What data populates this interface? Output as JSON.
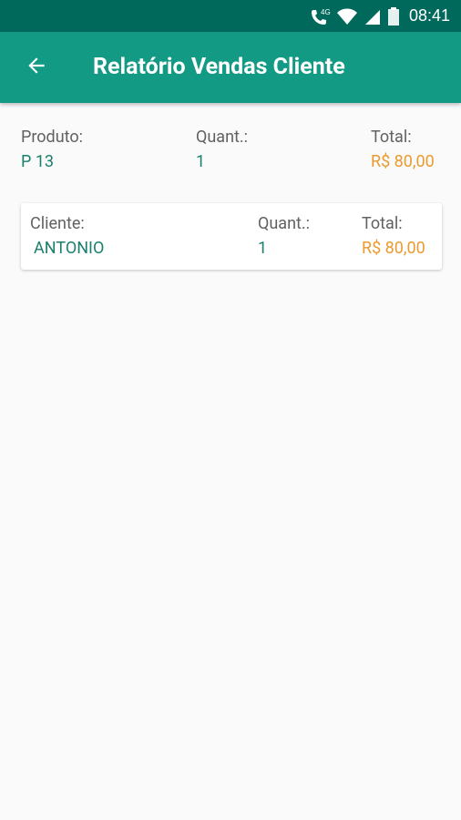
{
  "status_bar": {
    "time": "08:41",
    "network_label": "4G",
    "icons": [
      "call-4g-icon",
      "wifi-icon",
      "cell-signal-icon",
      "battery-icon"
    ]
  },
  "app_bar": {
    "title": "Relatório Vendas Cliente",
    "back_icon": "arrow-left-icon"
  },
  "summary": {
    "product_label": "Produto:",
    "product_value": "P 13",
    "quantity_label": "Quant.:",
    "quantity_value": "1",
    "total_label": "Total:",
    "total_value": "R$ 80,00"
  },
  "clients": [
    {
      "client_label": "Cliente:",
      "client_value": "ANTONIO",
      "quantity_label": "Quant.:",
      "quantity_value": "1",
      "total_label": "Total:",
      "total_value": "R$ 80,00"
    }
  ],
  "colors": {
    "status_bar": "#00695c",
    "app_bar": "#139a85",
    "green_text": "#1b7f6e",
    "orange_text": "#eb9a2f",
    "background": "#fafafa"
  }
}
